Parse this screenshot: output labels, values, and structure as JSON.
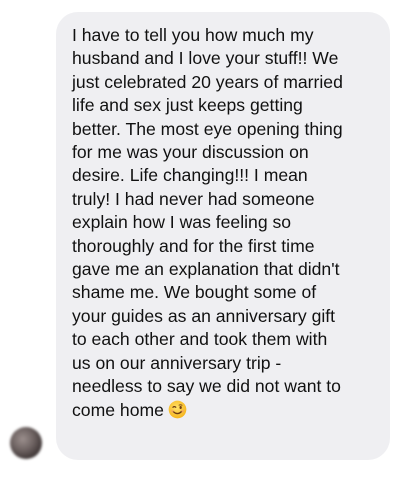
{
  "message": {
    "lines": [
      "I have to tell you how much my",
      "husband and I love your stuff!! We",
      "just celebrated 20 years of married",
      "life and sex just keeps getting",
      "better. The most eye opening thing",
      "for me was your discussion on",
      "desire. Life changing!!! I mean",
      "truly! I had never had someone",
      "explain how I was feeling so",
      "thoroughly and for the first time",
      "gave me an explanation that didn't",
      "shame me. We bought some of",
      "your guides as an anniversary gift",
      "to each other and took them with",
      "us on our anniversary trip -",
      "needless to say we did not want to",
      "come home"
    ],
    "emoji": "winking-face-icon"
  },
  "colors": {
    "bubble": "#efeff2",
    "text": "#111111"
  }
}
